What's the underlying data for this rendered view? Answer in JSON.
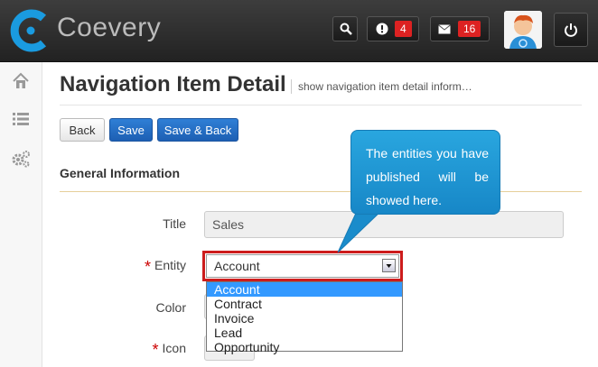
{
  "app": {
    "brand": "Coevery"
  },
  "topbar": {
    "search_icon": "search-icon",
    "alerts": {
      "icon": "exclamation-icon",
      "count": "4"
    },
    "messages": {
      "icon": "envelope-icon",
      "count": "16"
    },
    "avatar_icon": "user-avatar-icon",
    "power_icon": "power-icon"
  },
  "sidebar": {
    "items": [
      "home-icon",
      "list-icon",
      "gears-icon"
    ]
  },
  "page": {
    "title": "Navigation Item Detail",
    "subtitle": "show navigation item detail inform…"
  },
  "toolbar": {
    "back_label": "Back",
    "save_label": "Save",
    "save_back_label": "Save & Back"
  },
  "form": {
    "section_title": "General Information",
    "title_label": "Title",
    "title_value": "Sales",
    "entity_label": "Entity",
    "entity_value": "Account",
    "entity_options": [
      "Account",
      "Contract",
      "Invoice",
      "Lead",
      "Opportunity"
    ],
    "color_label": "Color",
    "icon_label": "Icon",
    "required_marker": "*"
  },
  "callout": {
    "text": "The entities you have published will be showed here."
  },
  "colors": {
    "accent": "#1d5fb3",
    "highlight": "#cc1c1c",
    "callout": "#1f97d4",
    "selection": "#3399ff"
  }
}
